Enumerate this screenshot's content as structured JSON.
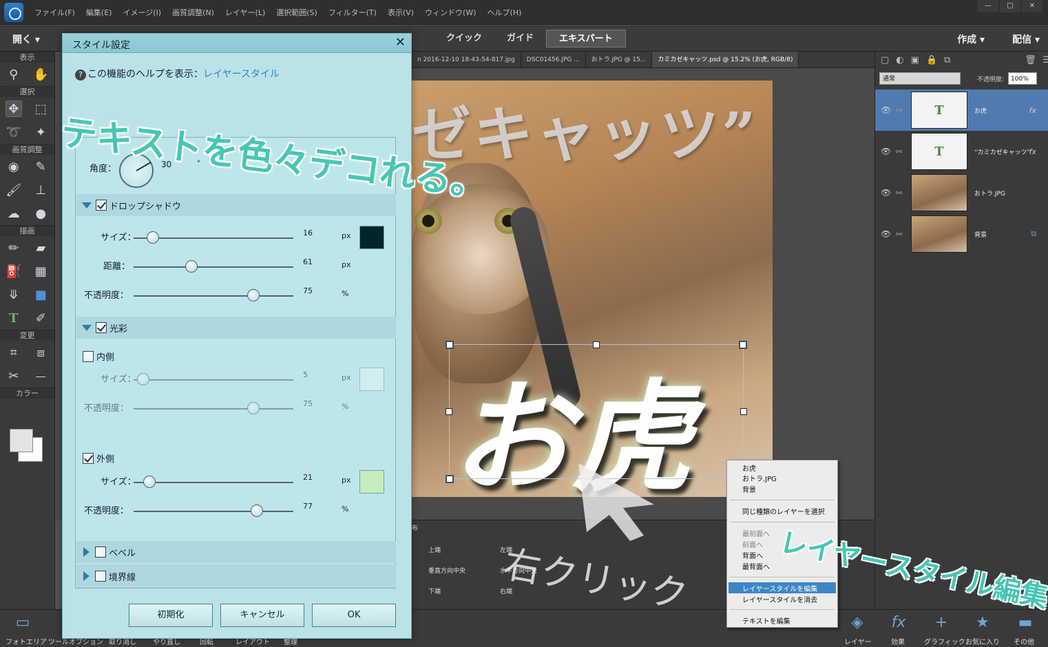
{
  "menubar": {
    "items": [
      "ファイル(F)",
      "編集(E)",
      "イメージ(I)",
      "画質調整(N)",
      "レイヤー(L)",
      "選択範囲(S)",
      "フィルター(T)",
      "表示(V)",
      "ウィンドウ(W)",
      "ヘルプ(H)"
    ]
  },
  "modebar": {
    "open": "開く",
    "modes": [
      "クイック",
      "ガイド",
      "エキスパート"
    ],
    "create": "作成",
    "share": "配信"
  },
  "toolbox": {
    "sections": [
      "表示",
      "選択",
      "画質調整",
      "描画",
      "変更",
      "カラー"
    ]
  },
  "tabs": [
    "n 2016-12-10 18-43-54-817.jpg",
    "DSC01456.JPG ...",
    "おトラ.JPG @ 15...",
    "カミカゼキャッツ.psd @ 15.2% (お虎, RGB/8)"
  ],
  "canvas": {
    "text_top": "ゼキャッツ”",
    "text_main": "お虎"
  },
  "layers": {
    "blend": "通常",
    "opacity_label": "不透明度:",
    "opacity_value": "100%",
    "items": [
      {
        "name": "お虎",
        "thumb": "T",
        "fx": "fx"
      },
      {
        "name": "“カミカゼキャッツ”",
        "thumb": "T",
        "fx": "fx"
      },
      {
        "name": "おトラ.JPG",
        "thumb": "",
        "fx": ""
      },
      {
        "name": "背景",
        "thumb": "",
        "fx": ""
      }
    ]
  },
  "bottomtools": {
    "header": "布",
    "items": [
      "上端",
      "垂直方向中央",
      "下端",
      "左端",
      "水平方向中央",
      "右端"
    ]
  },
  "context_menu": {
    "items": [
      "お虎",
      "おトラ.JPG",
      "背景",
      "同じ種類のレイヤーを選択",
      "最前面へ",
      "前面へ",
      "背面へ",
      "最背面へ",
      "レイヤースタイルを編集",
      "レイヤースタイルを消去",
      "テキストを編集"
    ]
  },
  "bottombar": {
    "left": [
      "フォトエリア",
      "ツールオプション",
      "取り消し",
      "やり直し",
      "回転",
      "レイアウト",
      "整理"
    ],
    "right": [
      "レイヤー",
      "効果",
      "グラフィック",
      "お気に入り",
      "その他"
    ]
  },
  "dialog": {
    "title": "スタイル設定",
    "help_prefix": "この機能のヘルプを表示：",
    "help_link": "レイヤースタイル",
    "angle_label": "角度：",
    "angle_value": "30",
    "angle_unit": "°",
    "drop_shadow": {
      "label": "ドロップシャドウ",
      "size_label": "サイズ：",
      "size": "16",
      "distance_label": "距離：",
      "distance": "61",
      "opacity_label": "不透明度：",
      "opacity": "75",
      "unit_px": "px",
      "unit_pct": "%",
      "color": "#00262b",
      "size_frac": 0.12,
      "distance_frac": 0.36,
      "opacity_frac": 0.75
    },
    "glow": {
      "label": "光彩",
      "inner_label": "内側",
      "inner_size": "5",
      "inner_opacity": "75",
      "outer_label": "外側",
      "outer_size": "21",
      "outer_opacity": "77",
      "size_label": "サイズ：",
      "opacity_label": "不透明度：",
      "outer_color": "#c6ecbf",
      "inner_size_frac": 0.06,
      "inner_opacity_frac": 0.75,
      "outer_size_frac": 0.1,
      "outer_opacity_frac": 0.77
    },
    "bevel": "ベベル",
    "stroke": "境界線",
    "buttons": {
      "reset": "初期化",
      "cancel": "キャンセル",
      "ok": "OK"
    }
  },
  "overlays": {
    "deco": "テキストを色々デコれる。",
    "edit": "レイヤースタイル編集",
    "rclick": "右クリック"
  }
}
